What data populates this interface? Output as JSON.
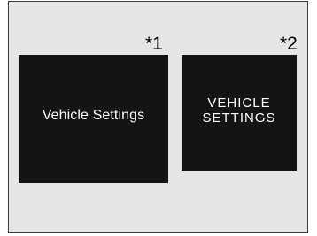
{
  "markers": {
    "first": "*1",
    "second": "*2"
  },
  "screens": [
    {
      "label": "Vehicle Settings"
    },
    {
      "label": "VEHICLE\nSETTINGS"
    }
  ],
  "colors": {
    "background": "#e6e6e6",
    "screen": "#141414",
    "text": "#ffffff"
  }
}
